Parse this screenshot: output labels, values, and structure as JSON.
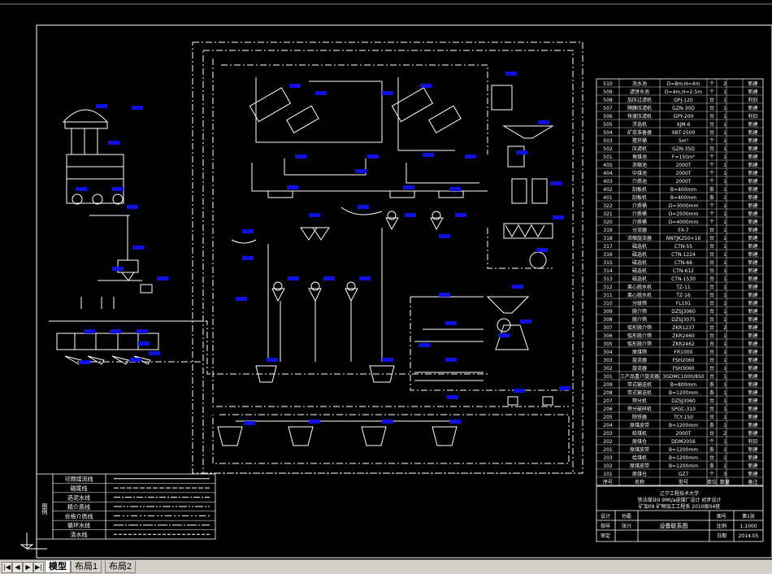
{
  "drawing": {
    "legend": {
      "title": "图例",
      "items": [
        "可燃煤流线",
        "磁尾线",
        "选泥水线",
        "精介质线",
        "合格介质线",
        "循环水线",
        "清水线"
      ]
    },
    "equipment_table": {
      "rows": [
        [
          "510",
          "洗水池",
          "D=8m,H=4m",
          "个",
          "2",
          "新建"
        ],
        [
          "509",
          "滤饼水池",
          "D=4m,H=2.5m",
          "个",
          "1",
          "新建"
        ],
        [
          "508",
          "加压过滤机",
          "GPJ-120",
          "台",
          "1",
          "利旧"
        ],
        [
          "507",
          "隔膜压滤机",
          "GZN-30D",
          "台",
          "1",
          "新建"
        ],
        [
          "506",
          "快速压滤机",
          "GPY-200",
          "台",
          "1",
          "利旧"
        ],
        [
          "505",
          "浮选机",
          "XJM-6",
          "台",
          "1",
          "新建"
        ],
        [
          "504",
          "矿浆准备器",
          "XBT-2500",
          "台",
          "1",
          "新建"
        ],
        [
          "503",
          "搅拌桶",
          "5m³",
          "个",
          "1",
          "新建"
        ],
        [
          "502",
          "压滤机",
          "GZN-35D",
          "台",
          "1",
          "新建"
        ],
        [
          "501",
          "角锥池",
          "F=150m²",
          "个",
          "1",
          "新建"
        ],
        [
          "405",
          "浓缩池",
          "2000T",
          "个",
          "1",
          "新建"
        ],
        [
          "404",
          "中煤池",
          "2000T",
          "个",
          "1",
          "新建"
        ],
        [
          "403",
          "介质池",
          "2000T",
          "个",
          "1",
          "新建"
        ],
        [
          "402",
          "刮板机",
          "B=400mm",
          "条",
          "1",
          "新建"
        ],
        [
          "401",
          "刮板机",
          "B=400mm",
          "条",
          "1",
          "新建"
        ],
        [
          "322",
          "介质桶",
          "D=3000mm",
          "个",
          "1",
          "新建"
        ],
        [
          "321",
          "介质桶",
          "D=2500mm",
          "个",
          "1",
          "新建"
        ],
        [
          "320",
          "介质桶",
          "D=4000mm",
          "个",
          "1",
          "新建"
        ],
        [
          "319",
          "分流器",
          "FX-7",
          "台",
          "1",
          "新建"
        ],
        [
          "318",
          "浓缩旋流器",
          "NNTJK250×16",
          "台",
          "1",
          "新建"
        ],
        [
          "317",
          "磁选机",
          "CTN-55",
          "台",
          "1",
          "新建"
        ],
        [
          "316",
          "磁选机",
          "CTN-1224",
          "台",
          "1",
          "新建"
        ],
        [
          "315",
          "磁选机",
          "CTN-66",
          "台",
          "1",
          "新建"
        ],
        [
          "314",
          "磁选机",
          "CTN-612",
          "台",
          "1",
          "新建"
        ],
        [
          "313",
          "磁选机",
          "CTN-1530",
          "台",
          "1",
          "新建"
        ],
        [
          "312",
          "离心脱水机",
          "TZ-11",
          "台",
          "1",
          "新建"
        ],
        [
          "311",
          "离心脱水机",
          "TZ-16",
          "台",
          "1",
          "新建"
        ],
        [
          "310",
          "分级筛",
          "FL101",
          "台",
          "1",
          "新建"
        ],
        [
          "309",
          "脱介筛",
          "DZSJ3060",
          "台",
          "1",
          "新建"
        ],
        [
          "308",
          "脱介筛",
          "DZSJ3075",
          "台",
          "1",
          "新建"
        ],
        [
          "307",
          "弧形脱介筛",
          "ZKR1237",
          "台",
          "2",
          "新建"
        ],
        [
          "306",
          "弧形脱介筛",
          "ZKR2460",
          "台",
          "1",
          "新建"
        ],
        [
          "305",
          "弧形脱介筛",
          "ZKR2462",
          "台",
          "1",
          "新建"
        ],
        [
          "304",
          "原煤筛",
          "FR1000",
          "台",
          "1",
          "新建"
        ],
        [
          "303",
          "旋流器",
          "FSH2060",
          "台",
          "1",
          "新建"
        ],
        [
          "302",
          "旋流器",
          "FSH3060",
          "台",
          "1",
          "新建"
        ],
        [
          "301",
          "三产品重介旋流器",
          "3GDMC1000/850",
          "台",
          "1",
          "新建"
        ],
        [
          "209",
          "带式输送机",
          "B=800mm",
          "条",
          "1",
          "新建"
        ],
        [
          "208",
          "带式输送机",
          "B=1200mm",
          "条",
          "1",
          "新建"
        ],
        [
          "207",
          "筛分机",
          "DZSJ3060",
          "台",
          "1",
          "新建"
        ],
        [
          "206",
          "筛分破碎机",
          "SPGC-310",
          "台",
          "1",
          "新建"
        ],
        [
          "205",
          "除铁器",
          "TCY-150",
          "台",
          "1",
          "新建"
        ],
        [
          "204",
          "原煤皮带",
          "B=1200mm",
          "条",
          "1",
          "新建"
        ],
        [
          "203",
          "给煤机",
          "2000T",
          "台",
          "2",
          "新建"
        ],
        [
          "202",
          "原煤仓",
          "DDM2056",
          "个",
          "1",
          "利旧"
        ],
        [
          "201",
          "原煤皮带",
          "B=1200mm",
          "条",
          "1",
          "新建"
        ],
        [
          "103",
          "给煤机",
          "B=1200mm",
          "台",
          "1",
          "新建"
        ],
        [
          "102",
          "原煤皮带",
          "B=1200mm",
          "条",
          "1",
          "新建"
        ],
        [
          "101",
          "原煤仓",
          "GZ7",
          "个",
          "3",
          "新建"
        ]
      ],
      "header": [
        "序号",
        "名称",
        "型号",
        "单位",
        "数量",
        "备注"
      ]
    },
    "title_block": {
      "school": "辽宁工程技术大学",
      "project": "铁法煤业0.9Mt/a选煤厂设计 初步设计",
      "class": "矿加09 矿物加工工程系 2010级04班",
      "drawing_title": "设备联系图",
      "labels": {
        "design": "设计",
        "check": "指导",
        "approve": "审定",
        "scale": "比例",
        "sheet": "图号",
        "date": "日期"
      },
      "values": {
        "designer": "孙磊",
        "checker": "张兴",
        "scale": "1:1000",
        "sheet": "第1张",
        "date": "2014.05"
      }
    }
  },
  "tabs": {
    "nav": [
      "|◀",
      "◀",
      "▶",
      "▶|"
    ],
    "items": [
      "模型",
      "布局1",
      "布局2"
    ],
    "active": "模型"
  },
  "colors": {
    "background": "#000000",
    "lines": "#ffffff",
    "tags": "#1010e0",
    "frame": "#ffffff"
  }
}
